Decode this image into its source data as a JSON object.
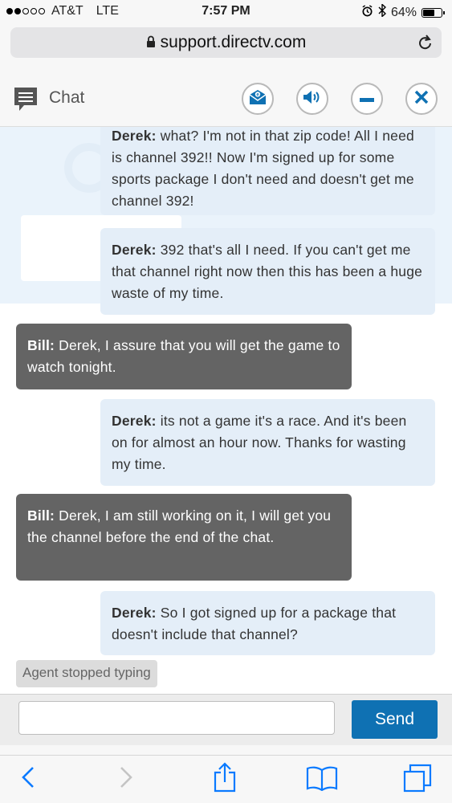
{
  "status_bar": {
    "carrier": "AT&T",
    "network": "LTE",
    "time": "7:57 PM",
    "battery_percent": "64%",
    "battery_level": 0.64
  },
  "browser": {
    "url": "support.directv.com"
  },
  "chat_header": {
    "title": "Chat",
    "buttons": [
      "email-icon",
      "speaker-icon",
      "minimize-icon",
      "close-icon"
    ],
    "accent_color": "#0f71b3"
  },
  "messages": [
    {
      "sender": "Derek:",
      "text": "what? I'm not in that zip code! All I need is channel 392!! Now I'm signed up for some sports package I don't need and doesn't get me channel 392!"
    },
    {
      "sender": "Derek:",
      "text": "392 that's all I need. If you can't get me that channel right now then this has been a huge waste of my time."
    },
    {
      "sender": "Bill:",
      "text": "Derek, I assure that you will get the game to watch tonight."
    },
    {
      "sender": "Derek:",
      "text": "its not a game it's a race. And it's been on for almost an hour now. Thanks for wasting my time."
    },
    {
      "sender": "Bill:",
      "text": "Derek, I am still working on it, I will get you the channel before the end of the chat."
    },
    {
      "sender": "Derek:",
      "text": "So I got signed up for a package that doesn't include that channel?"
    }
  ],
  "typing_status": "Agent stopped typing",
  "input": {
    "value": "",
    "send_label": "Send"
  },
  "toolbar": [
    "back-icon",
    "forward-icon",
    "share-icon",
    "bookmarks-icon",
    "tabs-icon"
  ]
}
